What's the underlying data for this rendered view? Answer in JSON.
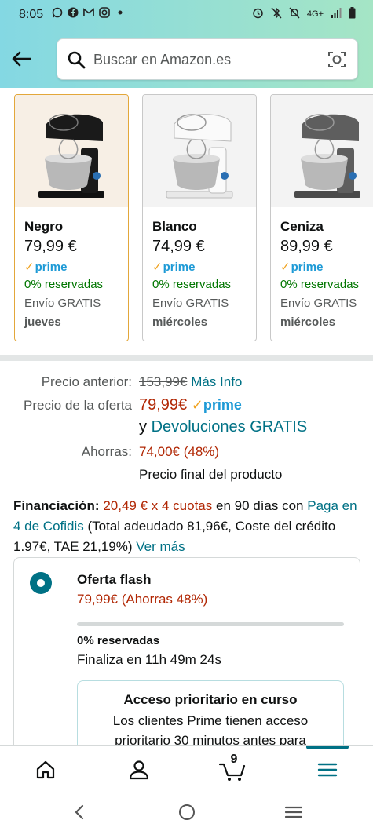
{
  "status_bar": {
    "time": "8:05",
    "network": "4G+",
    "left_icons": [
      "whatsapp-icon",
      "facebook-icon",
      "gmail-icon",
      "instagram-icon",
      "dot-icon"
    ],
    "right_icons": [
      "alarm-icon",
      "bluetooth-off-icon",
      "notifications-off-icon",
      "signal-icon",
      "battery-icon"
    ]
  },
  "search": {
    "placeholder": "Buscar en Amazon.es"
  },
  "variants": [
    {
      "name": "Negro",
      "price": "79,99 €",
      "prime": "prime",
      "reserved": "0% reservadas",
      "shipping": "Envío GRATIS",
      "day": "jueves",
      "color": "#1a1a1a",
      "selected": true
    },
    {
      "name": "Blanco",
      "price": "74,99 €",
      "prime": "prime",
      "reserved": "0% reservadas",
      "shipping": "Envío GRATIS",
      "day": "miércoles",
      "color": "#f2f2f2",
      "selected": false
    },
    {
      "name": "Ceniza",
      "price": "89,99 €",
      "prime": "prime",
      "reserved": "0% reservadas",
      "shipping": "Envío GRATIS",
      "day": "miércoles",
      "color": "#6e6e6e",
      "selected": false
    }
  ],
  "pricing": {
    "previous_label": "Precio anterior:",
    "previous_value": "153,99€",
    "more_info": "Más Info",
    "offer_label": "Precio de la oferta",
    "offer_value": "79,99€",
    "offer_prime": "prime",
    "returns_prefix": "y",
    "returns_link": "Devoluciones GRATIS",
    "savings_label": "Ahorras:",
    "savings_value": "74,00€ (48%)",
    "final_note": "Precio final del producto"
  },
  "financing": {
    "label": "Financiación:",
    "installments": "20,49 € x 4 cuotas",
    "days_text": "en 90 días con",
    "provider_link": "Paga en 4 de Cofidis",
    "details": "(Total adeudado 81,96€, Coste del crédito 1.97€, TAE 21,19%)",
    "more_link": "Ver más"
  },
  "flash_offer": {
    "title": "Oferta flash",
    "price": "79,99€ (Ahorras 48%)",
    "progress_fraction": 0.0,
    "reserved": "0% reservadas",
    "ends": "Finaliza en 11h 49m 24s",
    "priority_title": "Acceso prioritario en curso",
    "priority_text": "Los clientes Prime tienen acceso prioritario 30 minutos antes para"
  },
  "bottom_nav": {
    "items": [
      "home-icon",
      "account-icon",
      "cart-icon",
      "menu-icon"
    ],
    "cart_count": "9",
    "active": "menu-icon"
  },
  "colors": {
    "header_gradient_start": "#84d8e3",
    "header_gradient_end": "#a5e5c5",
    "link": "#007185",
    "price_red": "#b12704",
    "in_stock_green": "#007600",
    "prime_blue": "#1e9ad6",
    "selected_border": "#e3a73a"
  }
}
